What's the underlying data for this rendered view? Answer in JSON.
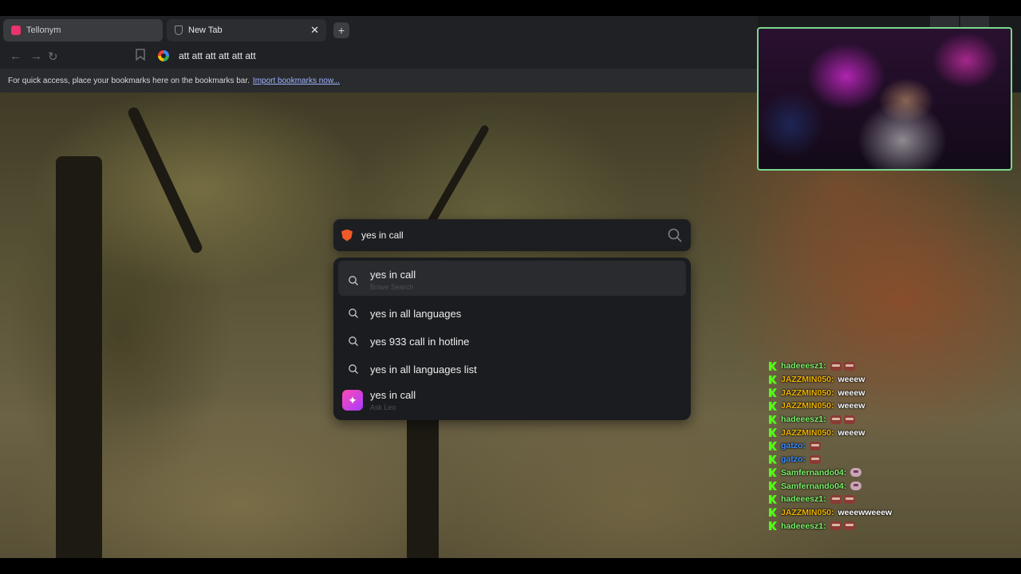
{
  "browser": {
    "tabs": [
      {
        "label": "Tellonym",
        "active": false
      },
      {
        "label": "New Tab",
        "active": true
      }
    ],
    "new_tab_symbol": "+",
    "close_symbol": "✕",
    "address_bar_text": "att att att att att att",
    "bookmarks_bar": {
      "message": "For quick access, place your bookmarks here on the bookmarks bar.",
      "import_link": "Import bookmarks now..."
    }
  },
  "search": {
    "query": "yes in call",
    "suggestions": [
      {
        "text": "yes in call",
        "subtext": "Brave Search",
        "icon": "search-icon",
        "active": true
      },
      {
        "text": "yes in all languages",
        "icon": "search-icon"
      },
      {
        "text": "yes 933 call in hotline",
        "icon": "search-icon"
      },
      {
        "text": "yes in all languages list",
        "icon": "search-icon"
      },
      {
        "text": "yes in call",
        "subtext": "Ask Leo",
        "icon": "leo-ai-icon"
      }
    ]
  },
  "chat": {
    "messages": [
      {
        "user": "hadeeesz1:",
        "color": "#7df26a",
        "text": "",
        "emotes": 2
      },
      {
        "user": "JAZZMIN050:",
        "color": "#f0b400",
        "text": "weeew",
        "emotes": 0
      },
      {
        "user": "JAZZMIN050:",
        "color": "#f0b400",
        "text": "weeew",
        "emotes": 0
      },
      {
        "user": "JAZZMIN050:",
        "color": "#f0b400",
        "text": "weeew",
        "emotes": 0
      },
      {
        "user": "hadeeesz1:",
        "color": "#7df26a",
        "text": "",
        "emotes": 2
      },
      {
        "user": "JAZZMIN050:",
        "color": "#f0b400",
        "text": "weeew",
        "emotes": 0
      },
      {
        "user": "gatzo:",
        "color": "#3a8dff",
        "text": "",
        "emotes": 1
      },
      {
        "user": "gatzo:",
        "color": "#3a8dff",
        "text": "",
        "emotes": 1
      },
      {
        "user": "Samfernando04:",
        "color": "#7df26a",
        "text": "",
        "emotes": 1,
        "ghost": true
      },
      {
        "user": "Samfernando04:",
        "color": "#7df26a",
        "text": "",
        "emotes": 1,
        "ghost": true
      },
      {
        "user": "hadeeesz1:",
        "color": "#7df26a",
        "text": "",
        "emotes": 2
      },
      {
        "user": "JAZZMIN050:",
        "color": "#f0b400",
        "text": "weeewweeew",
        "emotes": 0
      },
      {
        "user": "hadeeesz1:",
        "color": "#7df26a",
        "text": "",
        "emotes": 2
      }
    ]
  },
  "colors": {
    "webcam_border": "#7bd88f",
    "kick_green": "#53fc18",
    "link_blue": "#9db4ff"
  }
}
